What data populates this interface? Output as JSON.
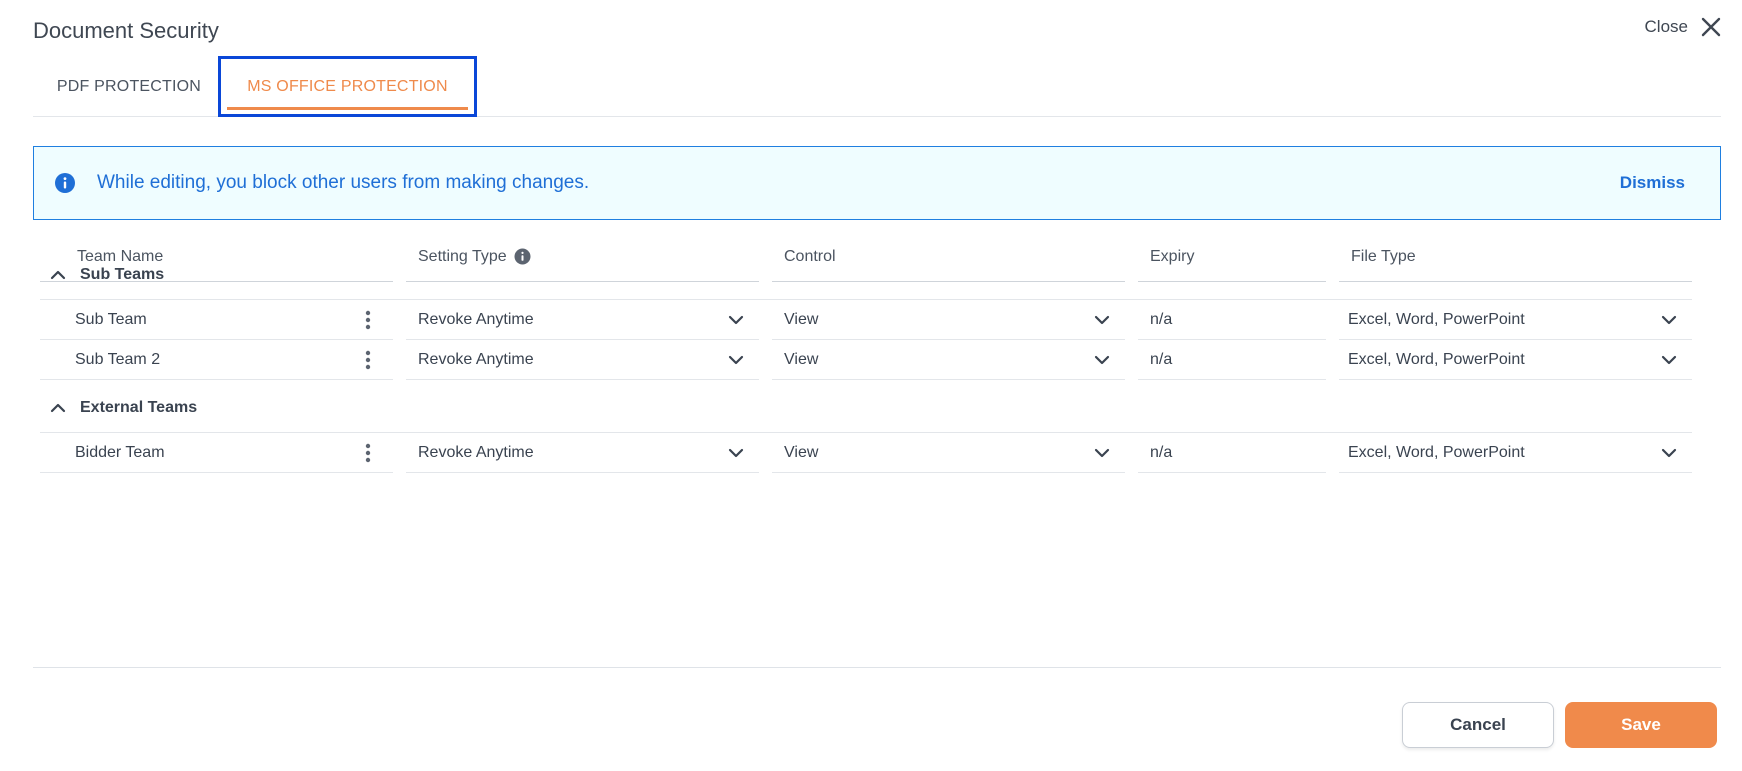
{
  "dialog": {
    "title": "Document Security",
    "close_label": "Close"
  },
  "tabs": [
    {
      "label": "PDF PROTECTION",
      "active": false
    },
    {
      "label": "MS OFFICE PROTECTION",
      "active": true
    }
  ],
  "banner": {
    "message": "While editing, you block other users from making changes.",
    "dismiss_label": "Dismiss"
  },
  "table": {
    "headers": [
      "Team Name",
      "Setting Type",
      "Control",
      "Expiry",
      "File Type"
    ],
    "groups": [
      {
        "name": "Sub Teams",
        "rows": [
          {
            "team": "Sub Team",
            "setting": "Revoke Anytime",
            "control": "View",
            "expiry": "n/a",
            "file_type": "Excel, Word, PowerPoint"
          },
          {
            "team": "Sub Team 2",
            "setting": "Revoke Anytime",
            "control": "View",
            "expiry": "n/a",
            "file_type": "Excel, Word, PowerPoint"
          }
        ]
      },
      {
        "name": "External Teams",
        "rows": [
          {
            "team": "Bidder Team",
            "setting": "Revoke Anytime",
            "control": "View",
            "expiry": "n/a",
            "file_type": "Excel, Word, PowerPoint"
          }
        ]
      }
    ]
  },
  "footer": {
    "cancel_label": "Cancel",
    "save_label": "Save"
  },
  "colors": {
    "accent": "#ef8a4b",
    "info": "#1f6fd6",
    "info_bg": "#effdff",
    "focus_outline": "#0a47d8"
  }
}
